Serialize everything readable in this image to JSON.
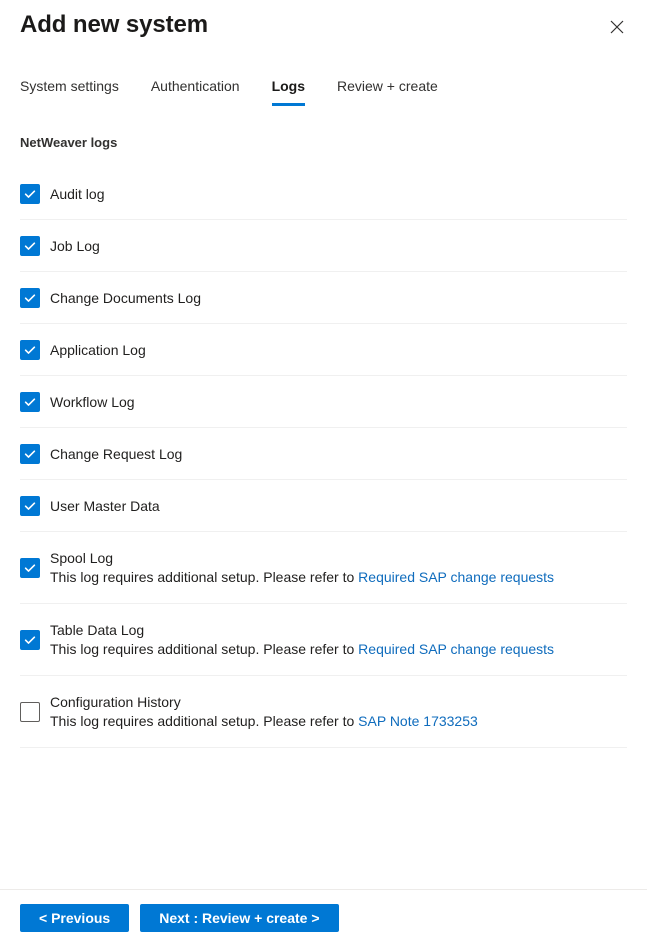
{
  "header": {
    "title": "Add new system",
    "close_icon": "close-icon"
  },
  "tabs": [
    {
      "label": "System settings",
      "selected": false
    },
    {
      "label": "Authentication",
      "selected": false
    },
    {
      "label": "Logs",
      "selected": true
    },
    {
      "label": "Review + create",
      "selected": false
    }
  ],
  "section": {
    "heading": "NetWeaver logs"
  },
  "logs": [
    {
      "label": "Audit log",
      "checked": true,
      "note": null,
      "link": null
    },
    {
      "label": "Job Log",
      "checked": true,
      "note": null,
      "link": null
    },
    {
      "label": "Change Documents Log",
      "checked": true,
      "note": null,
      "link": null
    },
    {
      "label": "Application Log",
      "checked": true,
      "note": null,
      "link": null
    },
    {
      "label": "Workflow Log",
      "checked": true,
      "note": null,
      "link": null
    },
    {
      "label": "Change Request Log",
      "checked": true,
      "note": null,
      "link": null
    },
    {
      "label": "User Master Data",
      "checked": true,
      "note": null,
      "link": null
    },
    {
      "label": "Spool Log",
      "checked": true,
      "note": "This log requires additional setup. Please refer to ",
      "link": "Required SAP change requests"
    },
    {
      "label": "Table Data Log",
      "checked": true,
      "note": "This log requires additional setup. Please refer to ",
      "link": "Required SAP change requests"
    },
    {
      "label": "Configuration History",
      "checked": false,
      "note": "This log requires additional setup. Please refer to ",
      "link": "SAP Note 1733253"
    }
  ],
  "footer": {
    "previous_label": "< Previous",
    "next_label": "Next : Review + create >"
  },
  "colors": {
    "accent": "#0078d4",
    "link": "#0f6cbd",
    "divider": "#f0f0f0",
    "text": "#201f1e"
  }
}
